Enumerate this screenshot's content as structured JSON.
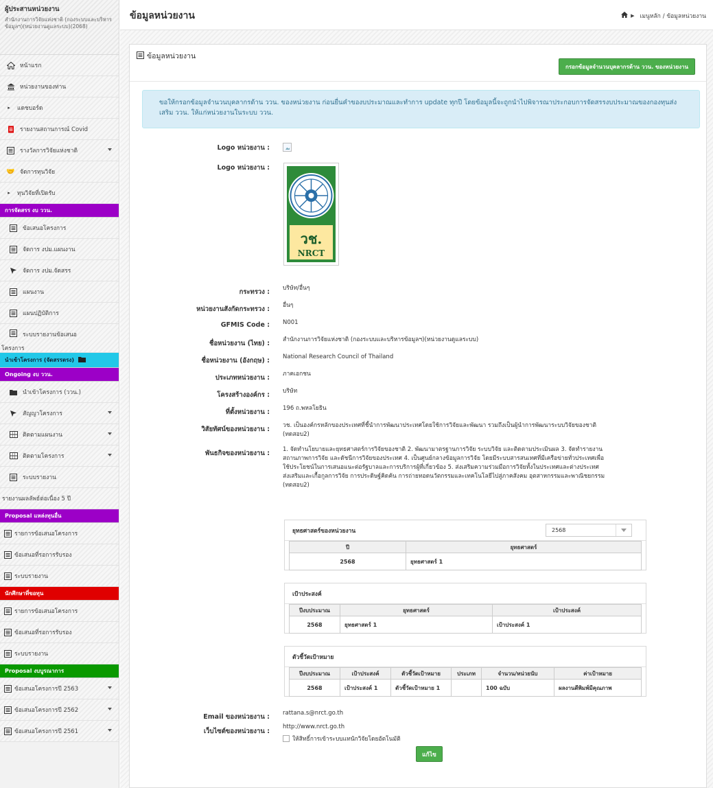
{
  "sidebar": {
    "user_name": "ผู้ประสานหน่วยงาน",
    "user_org": "สำนักงานการวิจัยแห่งชาติ (กองระบบและบริหารข้อมูลฯ)(หน่วยงานดูแลระบบ)(2068)",
    "items": [
      {
        "label": "หน้าแรก"
      },
      {
        "label": "หน่วยงานของท่าน"
      },
      {
        "label": "แดชบอร์ด"
      },
      {
        "label": "รายงานสถานการณ์ Covid"
      },
      {
        "label": "รางวัลการวิจัยแห่งชาติ"
      },
      {
        "label": "จัดการทุนวิจัย"
      },
      {
        "label": "ทุนวิจัยที่เปิดรับ"
      },
      {
        "label": "การจัดสรร งบ ววน."
      },
      {
        "label": "ข้อเสนอโครงการ"
      },
      {
        "label": "จัดการ งปม.แผนงาน"
      },
      {
        "label": "จัดการ งปม.จัดสรร"
      },
      {
        "label": "แผนงาน"
      },
      {
        "label": "แผนปฏิบัติการ"
      },
      {
        "label": "ระบบรายงานข้อเสนอ"
      },
      {
        "label": "โครงการ"
      },
      {
        "label": "นำเข้าโครงการ (จัดสรรตรง)"
      },
      {
        "label": "Ongoing งบ ววน."
      },
      {
        "label": "นำเข้าโครงการ (ววน.)"
      },
      {
        "label": "สัญญาโครงการ"
      },
      {
        "label": "ติดตามแผนงาน"
      },
      {
        "label": "ติดตามโครงการ"
      },
      {
        "label": "ระบบรายงาน"
      },
      {
        "label": "รายงานผลลัพธ์ต่อเนื่อง 5 ปี"
      },
      {
        "label": "Proposal แหล่งทุนอื่น"
      },
      {
        "label": "รายการข้อเสนอโครงการ"
      },
      {
        "label": "ข้อเสนอที่รอการรับรอง"
      },
      {
        "label": "ระบบรายงาน"
      },
      {
        "label": "นักศึกษาที่ขอทุน"
      },
      {
        "label": "รายการข้อเสนอโครงการ"
      },
      {
        "label": "ข้อเสนอที่รอการรับรอง"
      },
      {
        "label": "ระบบรายงาน"
      },
      {
        "label": "Proposal งบบูรณาการ"
      },
      {
        "label": "ข้อเสนอโครงการปี 2563"
      },
      {
        "label": "ข้อเสนอโครงการปี 2562"
      },
      {
        "label": "ข้อเสนอโครงการปี 2561"
      }
    ]
  },
  "header": {
    "title": "ข้อมูลหน่วยงาน",
    "breadcrumb_home": "เมนูหลัก",
    "breadcrumb_current": "/ ข้อมูลหน่วยงาน"
  },
  "panel": {
    "title": "ข้อมูลหน่วยงาน",
    "fill_button": "กรอกข้อมูลจำนวนบุคลากรด้าน ววน. ของหน่วยงาน",
    "info_text": "ขอให้กรอกข้อมูลจำนวนบุคลากรด้าน ววน. ของหน่วยงาน ก่อนยื่นคำของบประมาณและทำการ update ทุกปี โดยข้อมูลนี้จะถูกนำไปพิจารณาประกอบการจัดสรรงบประมาณของกองทุนส่งเสริม ววน. ให้แก่หน่วยงานในระบบ ววน."
  },
  "form": {
    "logo_label_1": "Logo หน่วยงาน :",
    "logo_label_2": "Logo หน่วยงาน :",
    "logo_text": "วช.",
    "logo_sub": "NRCT",
    "ministry_label": "กระทรวง :",
    "ministry": "บริษัท/อื่นๆ",
    "sub_ministry_label": "หน่วยงานสังกัดกระทรวง :",
    "sub_ministry": "อื่นๆ",
    "gfmis_label": "GFMIS Code :",
    "gfmis": "N001",
    "name_th_label": "ชื่อหน่วยงาน (ไทย) :",
    "name_th": "สำนักงานการวิจัยแห่งชาติ (กองระบบและบริหารข้อมูลฯ)(หน่วยงานดูแลระบบ)",
    "name_en_label": "ชื่อหน่วยงาน (อังกฤษ) :",
    "name_en": "National Research Council of Thailand",
    "type_label": "ประเภทหน่วยงาน :",
    "type": "ภาคเอกชน",
    "structure_label": "โครงสร้างองค์กร :",
    "structure": "บริษัท",
    "location_label": "ที่ตั้งหน่วยงาน :",
    "location": "196 ถ.พหลโยธิน",
    "vision_label": "วิสัยทัศน์ของหน่วยงาน :",
    "vision": "วช. เป็นองค์กรหลักของประเทศที่ชี้นำการพัฒนาประเทศโดยใช้การวิจัยและพัฒนา รวมถึงเป็นผู้นำการพัฒนาระบบวิจัยของชาติ (ทดสอบ2)",
    "mission_label": "พันธกิจของหน่วยงาน :",
    "mission": "1. จัดทำนโยบายและยุทธศาสตร์การวิจัยของชาติ 2. พัฒนามาตรฐานการวิจัย ระบบวิจัย และติดตามประเมินผล 3. จัดทำรายงานสถานภาพการวิจัย และดัชนีการวิจัยของประเทศ 4. เป็นศูนย์กลางข้อมูลการวิจัย โดยมีระบบสารสนเทศที่มีเครือข่ายทั่วประเทศเพื่อใช้ประโยชน์ในการเสนอแนะต่อรัฐบาลและการบริการผู้ที่เกี่ยวข้อง 5. ส่งเสริมความร่วมมือการวิจัยทั้งในประเทศและต่างประเทศ ส่งเสริมและเกื้อกูลการวิจัย การประดิษฐ์คิดค้น การถ่ายทอดนวัตกรรมและเทคโนโลยีไปสู่ภาคสังคม อุตสาหกรรมและพาณิชยกรรม (ทดสอบ2)",
    "email_label": "Email ของหน่วยงาน :",
    "email": "rattana.s@nrct.go.th",
    "website_label": "เว็บไซต์ของหน่วยงาน :",
    "website": "http://www.nrct.go.th",
    "checkbox_label": "ให้สิทธิ์การเข้าระบบแทนักวิจัยโดยอัตโนมัติ",
    "edit_button": "แก้ไข"
  },
  "strategy": {
    "title": "ยุทธศาสตร์ของหน่วยงาน",
    "selected_year": "2568",
    "col_year": "ปี",
    "col_strategy": "ยุทธศาสตร์",
    "rows": [
      {
        "year": "2568",
        "strategy": "ยุทธศาสตร์ 1"
      }
    ]
  },
  "goals": {
    "title": "เป้าประสงค์",
    "col_year": "ปีงบประมาณ",
    "col_strategy": "ยุทธศาสตร์",
    "col_goal": "เป้าประสงค์",
    "rows": [
      {
        "year": "2568",
        "strategy": "ยุทธศาสตร์ 1",
        "goal": "เป้าประสงค์ 1"
      }
    ]
  },
  "indicators": {
    "title": "ตัวชี้วัดเป้าหมาย",
    "col_year": "ปีงบประมาณ",
    "col_goal": "เป้าประสงค์",
    "col_indicator": "ตัวชี้วัดเป้าหมาย",
    "col_type": "ประเภท",
    "col_amount": "จำนวน/หน่วยนับ",
    "col_target": "ค่าเป้าหมาย",
    "rows": [
      {
        "year": "2568",
        "goal": "เป้าประสงค์ 1",
        "indicator": "ตัวชี้วัดเป้าหมาย 1",
        "type": "",
        "amount": "100 ฉบับ",
        "target": "ผลงานตีพิมพ์มีคุณภาพ"
      }
    ]
  }
}
